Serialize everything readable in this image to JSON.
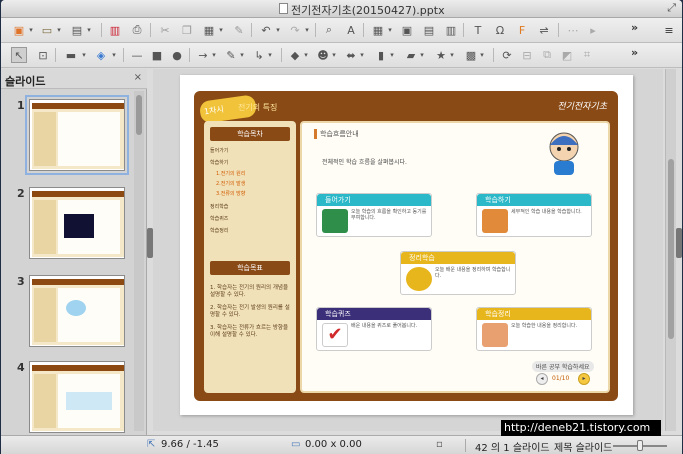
{
  "window": {
    "title": "전기전자기초(20150427).pptx"
  },
  "pane": {
    "title": "슬라이드",
    "thumbnails": [
      {
        "num": "1"
      },
      {
        "num": "2"
      },
      {
        "num": "3"
      },
      {
        "num": "4"
      }
    ]
  },
  "slide": {
    "badge": "1차시",
    "top_title": "전기의 특징",
    "brand": "전기전자기초",
    "left": {
      "contents_header": "학습목차",
      "menu": [
        "들어가기",
        "학습하기",
        "1.전기의 원리",
        "2.전기의 발생",
        "3.전류의 방향",
        "정리학습",
        "학습퀴즈",
        "학습정리"
      ],
      "objective_header": "학습목표",
      "objectives": [
        "1. 학습자는 전기의 원리의 개념을 설명할 수 있다.",
        "2. 학습자는 전기 발생의 원리를 설명할 수 있다.",
        "3. 학습자는 전류가 흐르는 방향을 이해 설명할 수 있다."
      ]
    },
    "main": {
      "title": "학습흐름안내",
      "intro": "전체적인 학습 흐름을 살펴봅시다.",
      "cards": [
        {
          "title": "들어가기",
          "text": "오늘 학습의 흐름을 확인하고 동기를 부여합니다.",
          "color": "#2bb8c8",
          "pic": "#2f8f4a"
        },
        {
          "title": "학습하기",
          "text": "세부적인 학습 내용을 학습합니다.",
          "color": "#2bb8c8",
          "pic": "#e08a3a"
        },
        {
          "title": "정리학습",
          "text": "오늘 배운 내용을 정리하며 학습합니다.",
          "color": "#e7b61d",
          "pic": "#e7b61d"
        },
        {
          "title": "학습퀴즈",
          "text": "배운 내용을 퀴즈로 풀어봅니다.",
          "color": "#3b2f7a",
          "pic": "#ffffff"
        },
        {
          "title": "학습정리",
          "text": "오늘 학습한 내용을 정리합니다.",
          "color": "#e7b61d",
          "pic": "#e8a070"
        }
      ],
      "footer_label": "바른 공부 학습하세요",
      "page": "01/10"
    }
  },
  "watermark": "http://deneb21.tistory.com",
  "status": {
    "position": "9.66 / -1.45",
    "size": "0.00 x 0.00",
    "slide_info": "42 의 1 슬라이드",
    "layout": "제목 슬라이드"
  }
}
